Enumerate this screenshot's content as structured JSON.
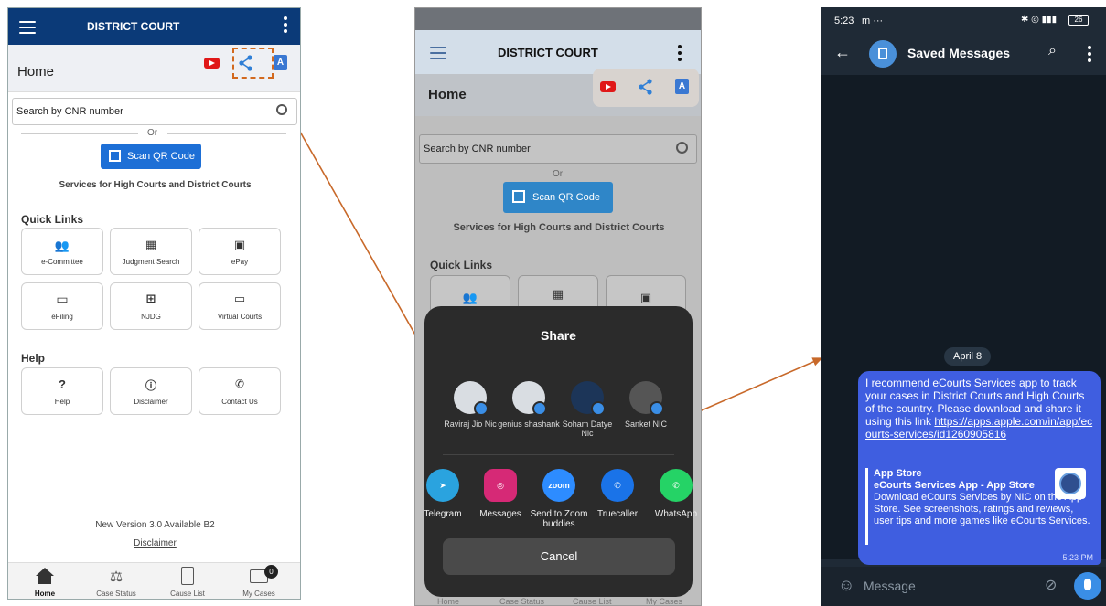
{
  "phone1": {
    "app_title": "DISTRICT COURT",
    "home_title": "Home",
    "search_placeholder": "Search by CNR number",
    "or_text": "Or",
    "scan_qr_label": "Scan QR Code",
    "services_text": "Services for High Courts and District Courts",
    "quick_links_heading": "Quick Links",
    "quick_links": [
      {
        "label": "e-Committee",
        "icon": "people-icon"
      },
      {
        "label": "Judgment Search",
        "icon": "book-icon"
      },
      {
        "label": "ePay",
        "icon": "wallet-icon"
      },
      {
        "label": "eFiling",
        "icon": "window-icon"
      },
      {
        "label": "NJDG",
        "icon": "dashboard-icon"
      },
      {
        "label": "Virtual Courts",
        "icon": "laptop-icon"
      }
    ],
    "help_heading": "Help",
    "help_links": [
      {
        "label": "Help",
        "icon": "question-icon"
      },
      {
        "label": "Disclaimer",
        "icon": "info-icon"
      },
      {
        "label": "Contact Us",
        "icon": "phone-icon"
      }
    ],
    "version_text": "New Version 3.0 Available B2",
    "disclaimer_link": "Disclaimer",
    "bottom_nav": [
      {
        "label": "Home"
      },
      {
        "label": "Case Status"
      },
      {
        "label": "Cause List"
      },
      {
        "label": "My Cases",
        "badge": "0"
      }
    ]
  },
  "phone2": {
    "app_title": "DISTRICT COURT",
    "home_title": "Home",
    "search_placeholder": "Search by CNR number",
    "or_text": "Or",
    "scan_qr_label": "Scan QR Code",
    "services_text": "Services for High Courts and District Courts",
    "quick_links_heading": "Quick Links",
    "share_sheet": {
      "title": "Share",
      "contacts": [
        "Raviraj Jio Nic",
        "genius shashank",
        "Soham Datye Nic",
        "Sanket NIC"
      ],
      "apps": [
        {
          "label": "Telegram",
          "color": "#2aa3df"
        },
        {
          "label": "Messages",
          "color": "#d62976"
        },
        {
          "label": "Send to Zoom buddies",
          "color": "#2d8cff",
          "icon_text": "zoom"
        },
        {
          "label": "Truecaller",
          "color": "#1a73e8"
        },
        {
          "label": "WhatsApp",
          "color": "#25d366"
        }
      ],
      "cancel_label": "Cancel"
    },
    "bottom_nav": [
      "Home",
      "Case Status",
      "Cause List",
      "My Cases"
    ]
  },
  "phone3": {
    "status_time": "5:23",
    "status_icon_text": "m ···",
    "battery": "26",
    "chat_title": "Saved Messages",
    "date_pill": "April 8",
    "message_text": "I recommend eCourts Services app to track your cases in District Courts and High Courts of the country. Please download and share it using this link ",
    "message_link": "https://apps.apple.com/in/app/ecourts-services/id1260905816",
    "preview_site": "App Store",
    "preview_title": "eCourts Services App - App Store",
    "preview_desc": "Download eCourts Services by NIC on the App Store. See screenshots, ratings and reviews, user tips and more games like eCourts Services.",
    "message_time": "5:23 PM",
    "input_placeholder": "Message"
  },
  "colors": {
    "court_blue": "#0b3a78",
    "qr_button": "#1d6fd6",
    "arrow": "#c8692a",
    "telegram_bubble": "#3f5ee0"
  }
}
